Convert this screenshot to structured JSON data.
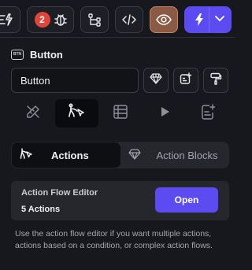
{
  "toolbar": {
    "notification_count": "2",
    "icons": [
      "ai-flash-icon",
      "bug-icon",
      "branch-icon",
      "code-icon",
      "eye-icon",
      "bolt-icon",
      "chevron-down-icon"
    ],
    "preview_color": "#8b5a44",
    "accent_color": "#5b4bf0"
  },
  "widget": {
    "type_label": "Button",
    "name_value": "Button"
  },
  "property_tabs": [
    "ruler-pencil-icon",
    "action-flow-icon",
    "table-icon",
    "play-icon",
    "add-document-icon"
  ],
  "segment": {
    "actions_label": "Actions",
    "action_blocks_label": "Action Blocks"
  },
  "editor": {
    "title": "Action Flow Editor",
    "count": "5 Actions",
    "open_label": "Open"
  },
  "help_text": "Use the action flow editor if you want multiple actions, actions based on a condition, or complex action flows."
}
